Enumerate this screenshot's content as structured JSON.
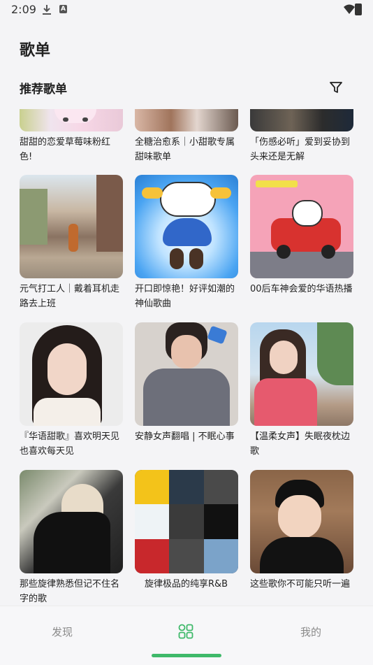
{
  "status_bar": {
    "time": "2:09"
  },
  "page": {
    "title": "歌单"
  },
  "section": {
    "title": "推荐歌单"
  },
  "playlists": [
    {
      "title": "甜甜的恋爱草莓味粉红色!"
    },
    {
      "title": "全糖治愈系｜小甜歌专属甜味歌单"
    },
    {
      "title": "「伤感必听」爱到妥协到头来还是无解"
    },
    {
      "title": "元气打工人｜戴着耳机走路去上班"
    },
    {
      "title": "开口即惊艳！好评如潮的神仙歌曲"
    },
    {
      "title": "00后车神会爱的华语热播"
    },
    {
      "title": "『华语甜歌』喜欢明天见也喜欢每天见"
    },
    {
      "title": "安静女声翻唱 | 不眠心事"
    },
    {
      "title": "【温柔女声】失眠夜枕边歌"
    },
    {
      "title": "那些旋律熟悉但记不住名字的歌"
    },
    {
      "title": "旋律极品的纯享R&B"
    },
    {
      "title": "这些歌你不可能只听一遍"
    }
  ],
  "bottom_nav": {
    "discover": "发现",
    "mine": "我的"
  },
  "colors": {
    "accent": "#3fb96a",
    "background": "#f4f4f6"
  }
}
